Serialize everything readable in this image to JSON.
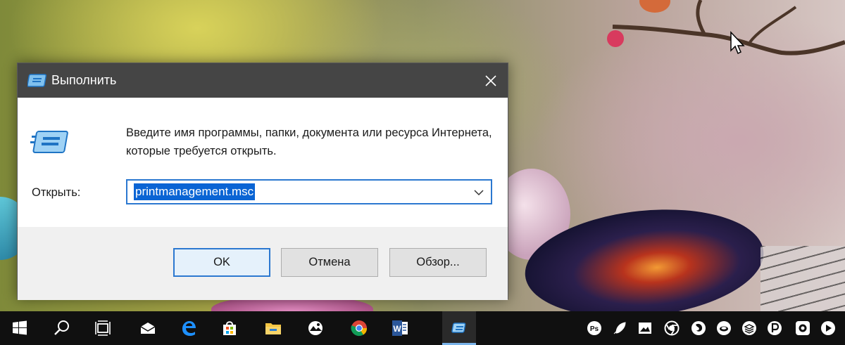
{
  "dialog": {
    "title": "Выполнить",
    "description": "Введите имя программы, папки, документа или ресурса Интернета, которые требуется открыть.",
    "open_label": "Открыть:",
    "open_value": "printmanagement.msc",
    "buttons": {
      "ok": "OK",
      "cancel": "Отмена",
      "browse": "Обзор..."
    }
  },
  "taskbar": {
    "items": [
      "start-icon",
      "search-icon",
      "task-view-icon",
      "mail-icon",
      "edge-icon",
      "store-icon",
      "file-explorer-icon",
      "photo-app-icon",
      "chrome-icon",
      "word-icon",
      "run-icon"
    ],
    "active_item": "run-icon"
  },
  "tray": {
    "items": [
      "photoshop-icon",
      "feather-icon",
      "image-viewer-icon",
      "chromium-icon",
      "firefox-icon",
      "cloud-icon",
      "layers-icon",
      "p-app-icon",
      "camera-icon",
      "player-icon"
    ]
  },
  "colors": {
    "titlebar": "#454545",
    "accent": "#2b78d0",
    "selection": "#0a64d4",
    "taskbar": "#101010",
    "footer": "#f0f0f0"
  }
}
